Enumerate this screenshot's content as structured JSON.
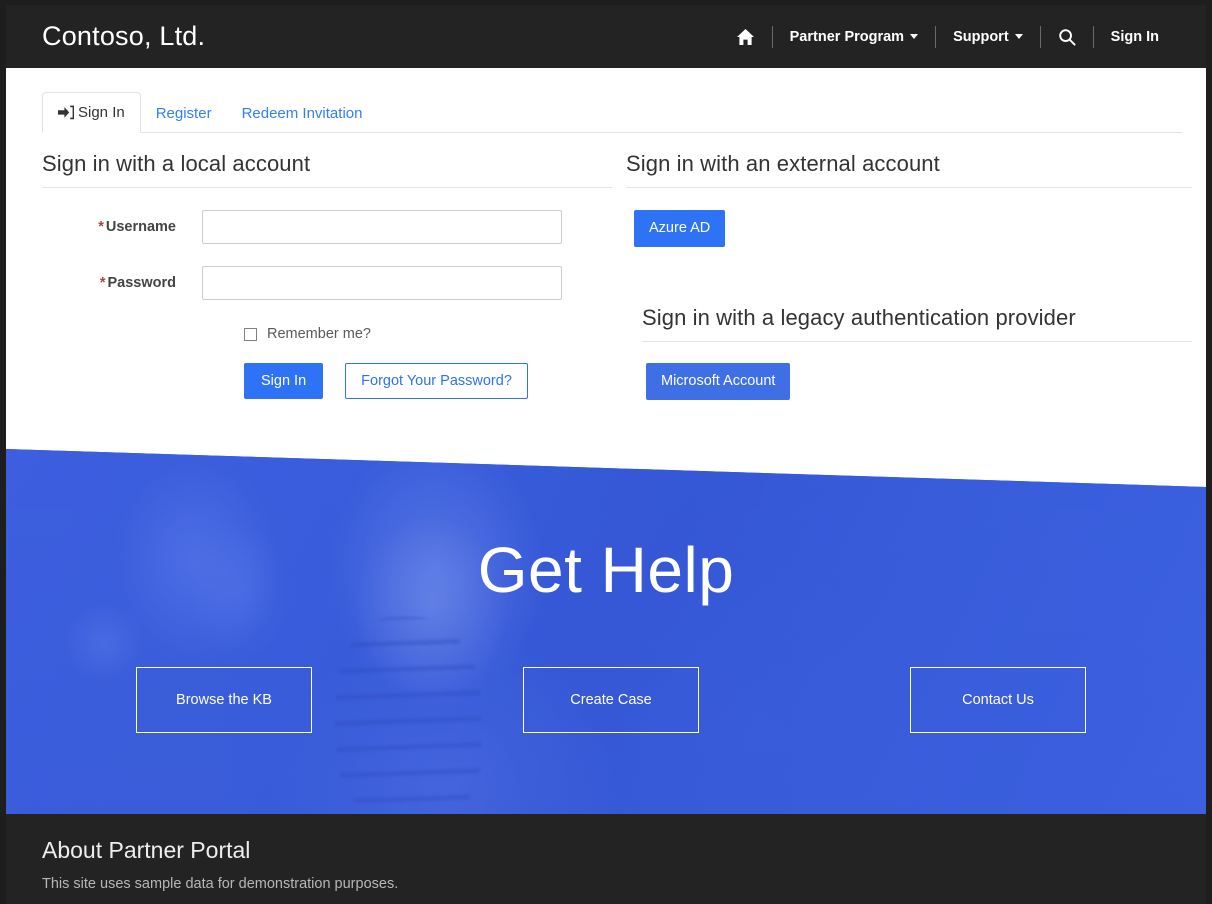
{
  "brand": {
    "name": "Contoso, Ltd."
  },
  "nav": {
    "home_icon": "home-icon",
    "items": [
      {
        "label": "Partner Program",
        "has_caret": true
      },
      {
        "label": "Support",
        "has_caret": true
      }
    ],
    "search_icon": "search-icon",
    "signin_label": "Sign In"
  },
  "tabs": [
    {
      "label": "Sign In",
      "active": true,
      "icon": "sign-in-icon"
    },
    {
      "label": "Register",
      "active": false
    },
    {
      "label": "Redeem Invitation",
      "active": false
    }
  ],
  "local": {
    "heading": "Sign in with a local account",
    "username_label": "Username",
    "username_value": "",
    "username_placeholder": "",
    "password_label": "Password",
    "password_value": "",
    "password_placeholder": "",
    "required_marker": "*",
    "remember_label": "Remember me?",
    "remember_checked": false,
    "signin_button": "Sign In",
    "forgot_button": "Forgot Your Password?"
  },
  "external": {
    "heading": "Sign in with an external account",
    "providers": [
      {
        "label": "Azure AD"
      }
    ],
    "legacy_heading": "Sign in with a legacy authentication provider",
    "legacy_providers": [
      {
        "label": "Microsoft Account"
      }
    ]
  },
  "hero": {
    "title": "Get Help",
    "buttons": [
      {
        "label": "Browse the KB"
      },
      {
        "label": "Create Case"
      },
      {
        "label": "Contact Us"
      }
    ]
  },
  "footer": {
    "title": "About Partner Portal",
    "text": "This site uses sample data for demonstration purposes."
  },
  "colors": {
    "navbar": "#232323",
    "accent_blue": "#2e72f6",
    "legacy_blue": "#3f6fe4",
    "hero_blue": "#3c63db",
    "link_blue": "#337ef7",
    "required_red": "#a94442"
  }
}
